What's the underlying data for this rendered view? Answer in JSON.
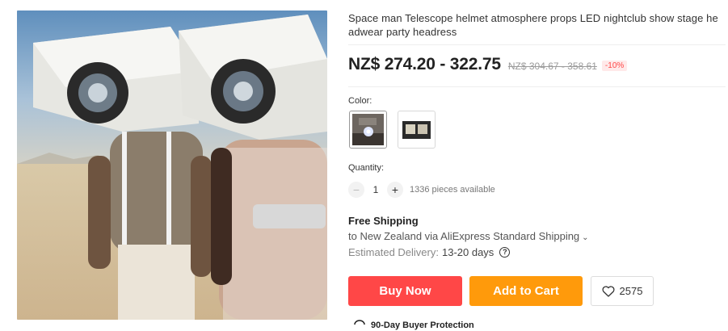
{
  "product": {
    "title": "Space man Telescope helmet atmosphere props LED nightclub show stage headwear party headress",
    "price_range": "NZ$ 274.20 - 322.75",
    "original_price_range": "NZ$ 304.67 - 358.61",
    "discount": "-10%"
  },
  "color": {
    "label": "Color:",
    "swatches": [
      {
        "name": "variant-1",
        "selected": true
      },
      {
        "name": "variant-2",
        "selected": false
      }
    ]
  },
  "quantity": {
    "label": "Quantity:",
    "value": "1",
    "minus": "−",
    "plus": "+",
    "available": "1336 pieces available"
  },
  "shipping": {
    "title": "Free Shipping",
    "route": "to New Zealand via AliExpress Standard Shipping",
    "delivery_label": "Estimated Delivery:",
    "delivery_days": "13-20 days",
    "help_glyph": "?"
  },
  "actions": {
    "buy_now": "Buy Now",
    "add_to_cart": "Add to Cart",
    "wishlist_count": "2575"
  },
  "protection": {
    "label": "90-Day Buyer Protection"
  },
  "colors": {
    "buy_now": "#ff4747",
    "add_to_cart": "#ff9a0b",
    "discount": "#ff4747"
  },
  "icons": [
    "chevron-down-icon",
    "help-circle-icon",
    "heart-icon",
    "shield-icon"
  ]
}
